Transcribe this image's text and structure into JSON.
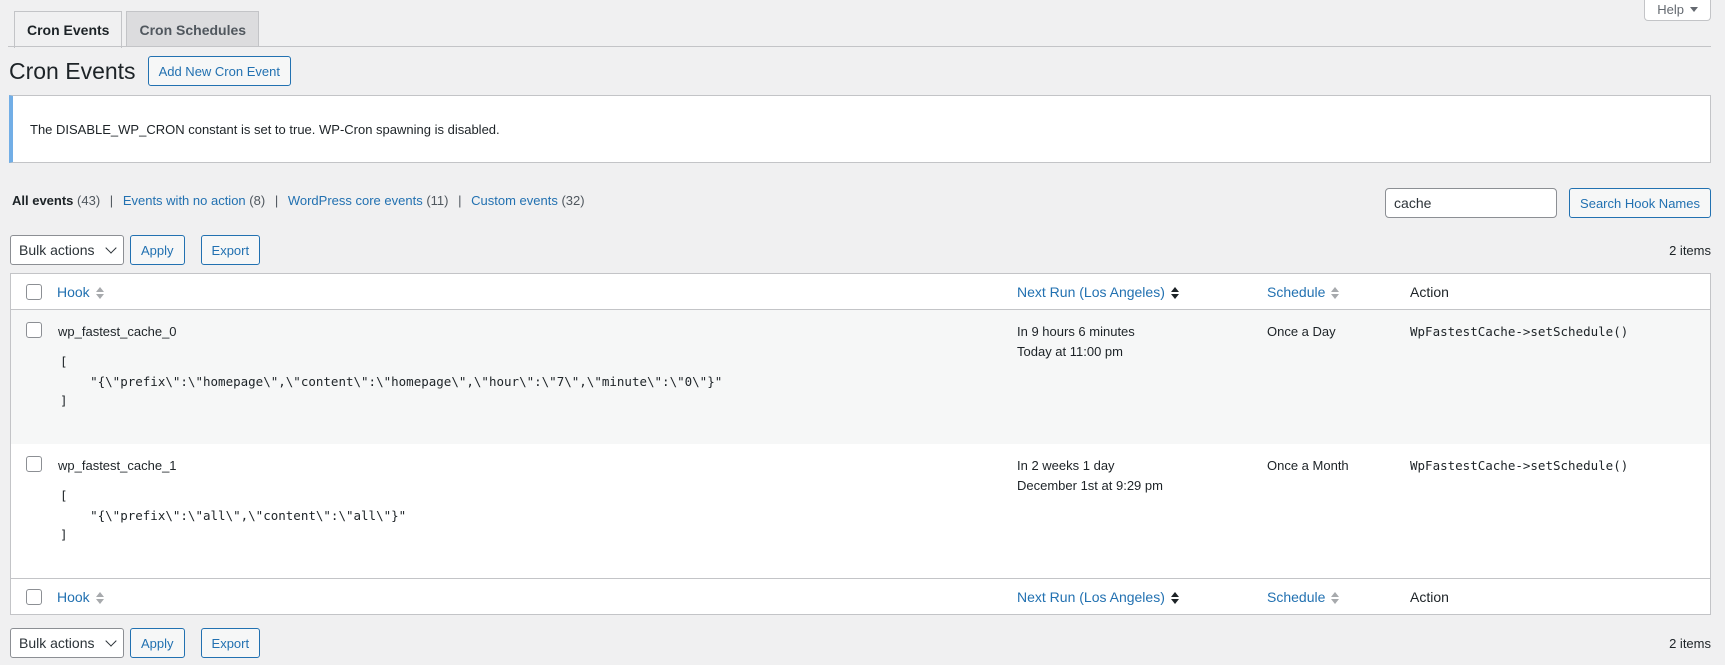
{
  "tabs": [
    {
      "label": "Cron Events",
      "active": true
    },
    {
      "label": "Cron Schedules",
      "active": false
    }
  ],
  "help_label": "Help",
  "page_title": "Cron Events",
  "add_new_label": "Add New Cron Event",
  "notice": "The DISABLE_WP_CRON constant is set to true. WP-Cron spawning is disabled.",
  "filters": [
    {
      "label": "All events",
      "count": "(43)"
    },
    {
      "label": "Events with no action",
      "count": "(8)"
    },
    {
      "label": "WordPress core events",
      "count": "(11)"
    },
    {
      "label": "Custom events",
      "count": "(32)"
    }
  ],
  "search": {
    "value": "cache",
    "button": "Search Hook Names"
  },
  "tablenav": {
    "bulk_actions": "Bulk actions",
    "apply": "Apply",
    "export": "Export",
    "count": "2 items"
  },
  "columns": {
    "hook": "Hook",
    "next_run": "Next Run (Los Angeles)",
    "schedule": "Schedule",
    "action": "Action"
  },
  "rows": [
    {
      "hook": "wp_fastest_cache_0",
      "args_open": "[",
      "args_value": "    \"{\\\"prefix\\\":\\\"homepage\\\",\\\"content\\\":\\\"homepage\\\",\\\"hour\\\":\\\"7\\\",\\\"minute\\\":\\\"0\\\"}\"",
      "args_close": "]",
      "next_run_relative": "In 9 hours 6 minutes",
      "next_run_absolute": "Today at 11:00 pm",
      "schedule": "Once a Day",
      "action": "WpFastestCache->setSchedule()"
    },
    {
      "hook": "wp_fastest_cache_1",
      "args_open": "[",
      "args_value": "    \"{\\\"prefix\\\":\\\"all\\\",\\\"content\\\":\\\"all\\\"}\"",
      "args_close": "]",
      "next_run_relative": "In 2 weeks 1 day",
      "next_run_absolute": "December 1st at 9:29 pm",
      "schedule": "Once a Month",
      "action": "WpFastestCache->setSchedule()"
    }
  ],
  "colors": {
    "link": "#2271b1",
    "notice_border": "#72aee6",
    "background": "#f0f0f1"
  }
}
